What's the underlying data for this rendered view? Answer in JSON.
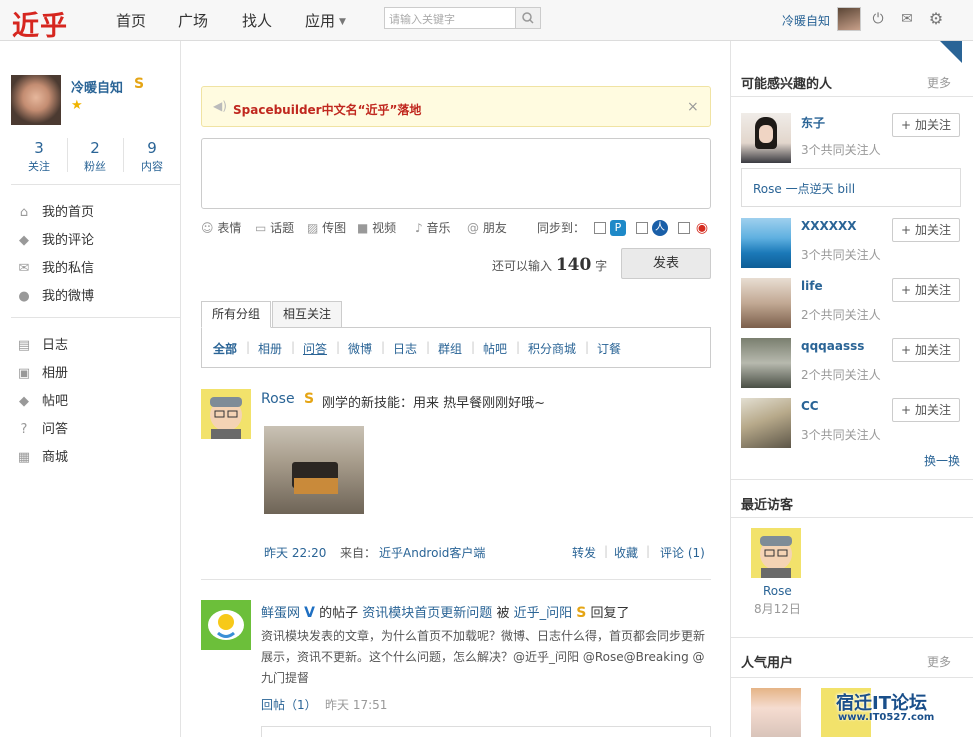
{
  "header": {
    "logo": "近乎",
    "nav": [
      "首页",
      "广场",
      "找人",
      "应用"
    ],
    "search_placeholder": "请输入关键字",
    "username": "冷暖自知"
  },
  "profile": {
    "name": "冷暖自知",
    "badge": "S",
    "stats": [
      {
        "value": "3",
        "label": "关注"
      },
      {
        "value": "2",
        "label": "粉丝"
      },
      {
        "value": "9",
        "label": "内容"
      }
    ],
    "menu_primary": [
      {
        "icon": "home-icon",
        "label": "我的首页"
      },
      {
        "icon": "comment-icon",
        "label": "我的评论"
      },
      {
        "icon": "mail-icon",
        "label": "我的私信"
      },
      {
        "icon": "weibo-icon",
        "label": "我的微博"
      }
    ],
    "menu_secondary": [
      {
        "icon": "blog-icon",
        "label": "日志"
      },
      {
        "icon": "album-icon",
        "label": "相册"
      },
      {
        "icon": "forum-icon",
        "label": "帖吧"
      },
      {
        "icon": "qa-icon",
        "label": "问答"
      },
      {
        "icon": "shop-icon",
        "label": "商城"
      }
    ]
  },
  "notice": {
    "text": "Spacebuilder中文名“近乎”落地",
    "close": "×"
  },
  "composer": {
    "tools": [
      "表情",
      "话题",
      "传图",
      "视频",
      "音乐",
      "朋友"
    ],
    "sync_label": "同步到：",
    "remaining_prefix": "还可以输入",
    "remaining_count": "140",
    "remaining_suffix": "字",
    "publish": "发表"
  },
  "feed_tabs": [
    "所有分组",
    "相互关注"
  ],
  "filters": [
    "全部",
    "相册",
    "问答",
    "微博",
    "日志",
    "群组",
    "帖吧",
    "积分商城",
    "订餐"
  ],
  "feed": [
    {
      "author": "Rose",
      "badge": "S",
      "text": "刚学的新技能：用来 热早餐刚刚好哦~",
      "time": "昨天 22:20",
      "source_label": "来自：",
      "source": "近乎Android客户端",
      "actions": [
        "转发",
        "收藏",
        "评论 (1)"
      ]
    },
    {
      "author": "鲜蛋网",
      "vbadge": "V",
      "mid1": "的帖子",
      "topic": "资讯模块首页更新问题",
      "mid2": "被",
      "replier": "近乎_问阳",
      "badge": "S",
      "mid3": "回复了",
      "body": "资讯模块发表的文章，为什么首页不加载呢？微博、日志什么得，首页都会同步更新展示，资讯不更新。这个什么问题，怎么解决？@近乎_问阳 @Rose@Breaking @九门提督",
      "reply_label": "回帖（1）",
      "time": "昨天 17:51"
    }
  ],
  "sidebar": {
    "interested_title": "可能感兴趣的人",
    "more": "更多",
    "people": [
      {
        "name": "东子",
        "meta": "3个共同关注人"
      },
      {
        "name": "XXXXXX",
        "meta": "3个共同关注人"
      },
      {
        "name": "life",
        "meta": "2个共同关注人"
      },
      {
        "name": "qqqaasss",
        "meta": "2个共同关注人"
      },
      {
        "name": "CC",
        "meta": "3个共同关注人"
      }
    ],
    "first_person_post": "Rose 一点逆天 bill",
    "follow_label": "加关注",
    "refresh": "换一换",
    "visitors_title": "最近访客",
    "visitor": {
      "name": "Rose",
      "date": "8月12日"
    },
    "popular_title": "人气用户",
    "popular_more": "更多",
    "watermark_line1": "宿迁IT论坛",
    "watermark_line2": "www.IT0527.com"
  },
  "colors": {
    "brand": "#d6261f",
    "link": "#2a6496",
    "notice_bg": "#fffbe0"
  }
}
